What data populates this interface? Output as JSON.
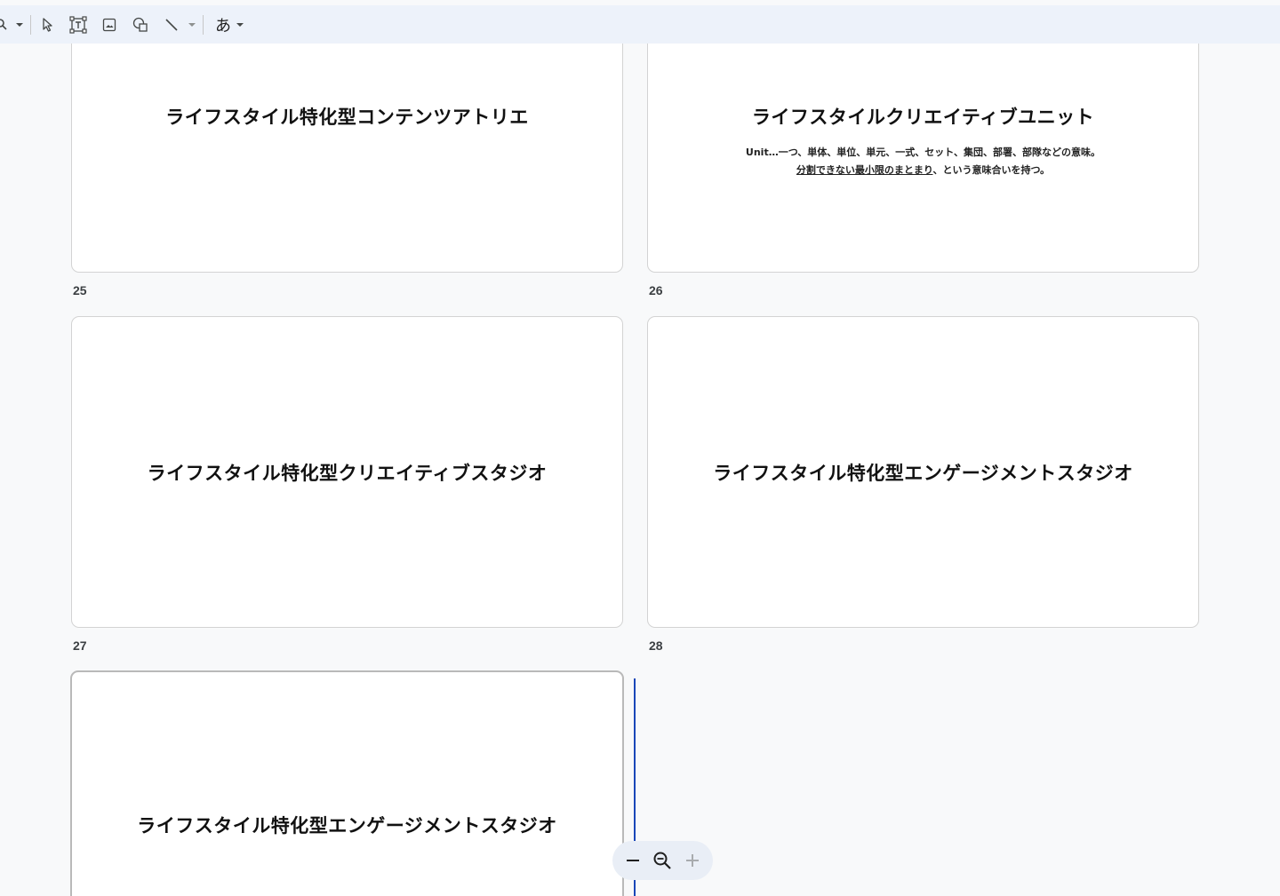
{
  "toolbar": {
    "items": [
      {
        "name": "zoom-icon"
      },
      {
        "name": "select-pointer-icon"
      },
      {
        "name": "text-box-icon"
      },
      {
        "name": "image-icon"
      },
      {
        "name": "shape-icon"
      },
      {
        "name": "line-icon"
      }
    ],
    "input_tools_label": "あ"
  },
  "slides": [
    {
      "number": "25",
      "title": "ライフスタイル特化型コンテンツアトリエ",
      "body_line1": "",
      "body_line2_underlined": "",
      "body_line2_rest": ""
    },
    {
      "number": "26",
      "title": "ライフスタイルクリエイティブユニット",
      "body_line1": "Unit…一つ、単体、単位、単元、一式、セット、集団、部署、部隊などの意味。",
      "body_line2_underlined": "分割できない最小限のまとまり",
      "body_line2_rest": "、という意味合いを持つ。"
    },
    {
      "number": "27",
      "title": "ライフスタイル特化型クリエイティブスタジオ"
    },
    {
      "number": "28",
      "title": "ライフスタイル特化型エンゲージメントスタジオ"
    },
    {
      "number": "",
      "title": "ライフスタイル特化型エンゲージメントスタジオ"
    }
  ],
  "zoom": {
    "zoom_out_label": "−",
    "zoom_in_label": "+"
  },
  "colors": {
    "toolbar_bg": "#edf2fa",
    "insertion_line": "#1a47b8",
    "canvas_bg": "#f8f9fa"
  }
}
